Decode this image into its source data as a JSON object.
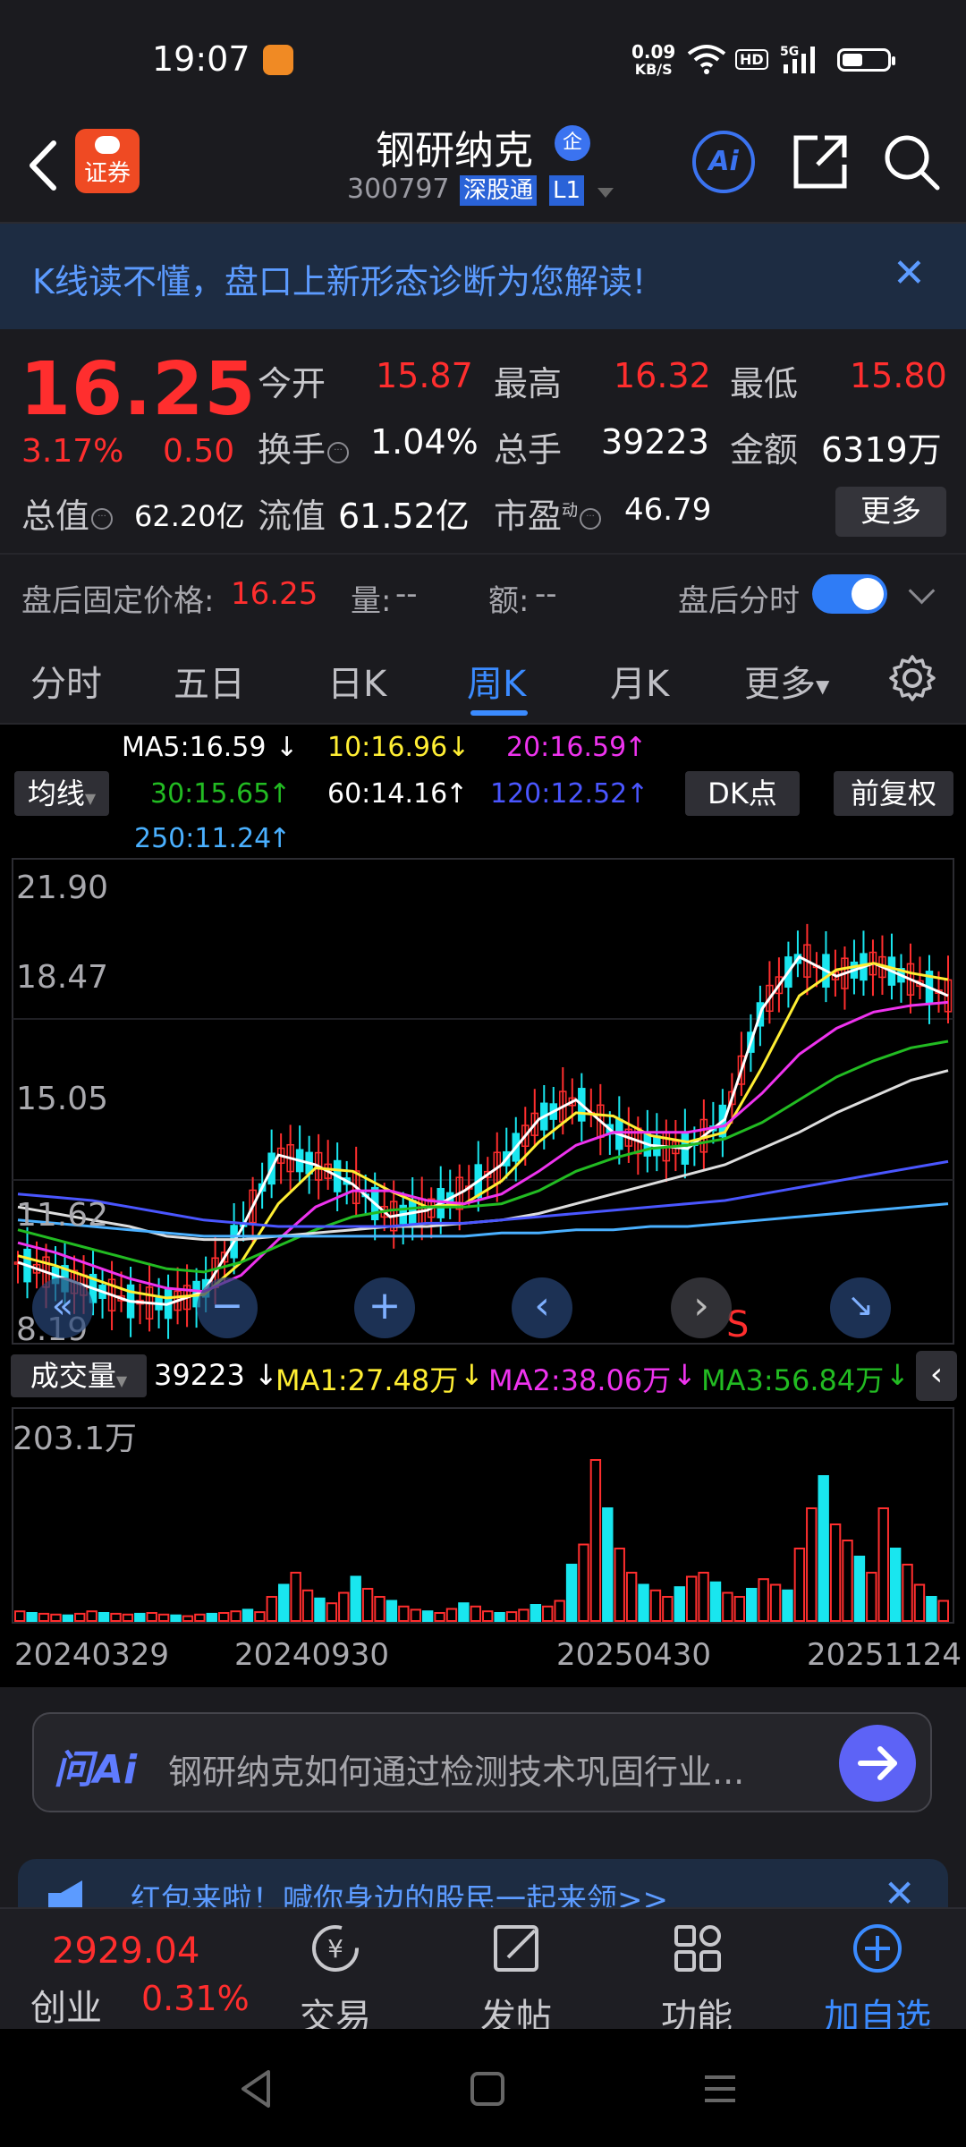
{
  "status_bar": {
    "time": "19:07",
    "net_speed": "0.09",
    "net_unit": "KB/S",
    "hd": "HD",
    "signal": "5G"
  },
  "header": {
    "title": "钢研纳克",
    "title_badge": "企",
    "code": "300797",
    "tag1": "深股通",
    "tag2": "L1",
    "brand_label": "证券",
    "ai_label": "Ai"
  },
  "banner": {
    "text": "K线读不懂，盘口上新形态诊断为您解读!"
  },
  "quote": {
    "price": "16.25",
    "change_pct": "3.17%",
    "change": "0.50",
    "open_label": "今开",
    "open": "15.87",
    "high_label": "最高",
    "high": "16.32",
    "low_label": "最低",
    "low": "15.80",
    "turnover_label": "换手",
    "turnover": "1.04%",
    "volume_label": "总手",
    "volume": "39223",
    "amount_label": "金额",
    "amount": "6319万",
    "mcap_label": "总值",
    "mcap": "62.20亿",
    "float_label": "流值",
    "float_cap": "61.52亿",
    "pe_label": "市盈",
    "pe_sup": "动",
    "pe": "46.79",
    "more": "更多"
  },
  "after_hours": {
    "label": "盘后固定价格:",
    "price": "16.25",
    "vol_label": "量:",
    "vol": "--",
    "amt_label": "额:",
    "amt": "--",
    "toggle_label": "盘后分时"
  },
  "tabs": [
    "分时",
    "五日",
    "日K",
    "周K",
    "月K",
    "更多"
  ],
  "active_tab": "周K",
  "ma": {
    "selector": "均线",
    "ma5": "MA5:16.59",
    "ma10": "10:16.96",
    "ma20": "20:16.59",
    "ma30": "30:15.65",
    "ma60": "60:14.16",
    "ma120": "120:12.52",
    "ma250": "250:11.24",
    "dk": "DK点",
    "fq": "前复权"
  },
  "colors": {
    "up": "#ff2e2e",
    "cyan": "#19e6ef",
    "ma5": "#ffffff",
    "ma10": "#ffee33",
    "ma20": "#ee33ee",
    "ma30": "#22bb22",
    "ma60": "#dddddd",
    "ma120": "#4a56ff",
    "ma250": "#4ab0ff",
    "accent": "#3b8bff"
  },
  "chart_data": [
    {
      "type": "candlestick",
      "title": "",
      "yticks": [
        "21.90",
        "18.47",
        "15.05",
        "11.62",
        "8.19"
      ],
      "ylim": [
        8.19,
        21.9
      ],
      "x_dates": [
        "20240329",
        "20240930",
        "20250430",
        "20251124"
      ],
      "marker_s": "S",
      "series": [
        {
          "name": "MA5",
          "values": [
            10.2,
            9.8,
            9.4,
            9.0,
            8.9,
            9.3,
            11.2,
            13.5,
            13.2,
            12.6,
            11.6,
            11.8,
            12.4,
            13.2,
            14.6,
            15.2,
            14.2,
            13.8,
            13.7,
            14.6,
            18.0,
            19.6,
            19.0,
            19.4,
            18.9,
            18.4
          ]
        },
        {
          "name": "MA10",
          "values": [
            10.4,
            10.1,
            9.7,
            9.3,
            9.1,
            9.2,
            10.2,
            12.0,
            13.1,
            13.0,
            12.4,
            11.9,
            12.0,
            12.7,
            13.9,
            14.8,
            14.7,
            14.1,
            13.9,
            14.2,
            16.2,
            18.4,
            19.2,
            19.4,
            19.1,
            18.9
          ]
        },
        {
          "name": "MA20",
          "values": [
            10.8,
            10.5,
            10.1,
            9.7,
            9.4,
            9.3,
            9.8,
            10.9,
            11.9,
            12.4,
            12.4,
            12.1,
            12.0,
            12.3,
            13.0,
            13.8,
            14.2,
            14.2,
            14.2,
            14.4,
            15.4,
            16.6,
            17.4,
            17.9,
            18.1,
            18.2
          ]
        },
        {
          "name": "MA30",
          "values": [
            11.2,
            10.9,
            10.6,
            10.3,
            10.0,
            9.9,
            10.2,
            10.7,
            11.2,
            11.6,
            11.8,
            11.9,
            11.9,
            12.0,
            12.4,
            13.0,
            13.4,
            13.7,
            13.8,
            14.0,
            14.5,
            15.2,
            15.9,
            16.4,
            16.8,
            17.0
          ]
        },
        {
          "name": "MA60",
          "values": [
            11.9,
            11.7,
            11.5,
            11.3,
            11.0,
            10.9,
            10.9,
            11.0,
            11.1,
            11.2,
            11.3,
            11.3,
            11.4,
            11.5,
            11.7,
            12.0,
            12.3,
            12.6,
            12.9,
            13.2,
            13.7,
            14.2,
            14.8,
            15.3,
            15.8,
            16.1
          ]
        },
        {
          "name": "MA120",
          "values": [
            12.3,
            12.2,
            12.1,
            11.9,
            11.7,
            11.5,
            11.4,
            11.3,
            11.3,
            11.3,
            11.3,
            11.4,
            11.4,
            11.5,
            11.6,
            11.7,
            11.8,
            11.9,
            12.0,
            12.1,
            12.3,
            12.5,
            12.7,
            12.9,
            13.1,
            13.3
          ]
        },
        {
          "name": "MA250",
          "values": [
            11.5,
            11.4,
            11.3,
            11.2,
            11.1,
            11.0,
            11.0,
            11.0,
            11.0,
            11.0,
            11.0,
            11.0,
            11.0,
            11.1,
            11.1,
            11.2,
            11.2,
            11.3,
            11.3,
            11.4,
            11.5,
            11.6,
            11.7,
            11.8,
            11.9,
            12.0
          ]
        }
      ]
    },
    {
      "type": "bar",
      "title": "成交量",
      "current": "39223",
      "ma1": "MA1:27.48万",
      "ma2": "MA2:38.06万",
      "ma3": "MA3:56.84万",
      "ymax_label": "203.1万",
      "values": [
        12,
        10,
        9,
        8,
        7,
        9,
        12,
        10,
        9,
        8,
        9,
        10,
        8,
        7,
        6,
        8,
        9,
        10,
        12,
        14,
        11,
        30,
        45,
        60,
        38,
        28,
        22,
        35,
        55,
        40,
        30,
        25,
        18,
        14,
        12,
        10,
        15,
        22,
        18,
        12,
        10,
        11,
        14,
        20,
        18,
        25,
        70,
        95,
        200,
        140,
        90,
        60,
        45,
        38,
        30,
        42,
        55,
        60,
        48,
        35,
        30,
        40,
        52,
        45,
        38,
        90,
        140,
        180,
        120,
        100,
        80,
        60,
        140,
        90,
        70,
        45,
        30,
        25
      ]
    }
  ],
  "chart_controls": [
    "«",
    "−",
    "+",
    "‹",
    "›",
    "↘"
  ],
  "ask_ai": {
    "logo": "问Ai",
    "text": "钢研纳克如何通过检测技术巩固行业..."
  },
  "redpack": {
    "text": "红包来啦！喊你身边的股民一起来领>>"
  },
  "bottom_nav": {
    "index_value": "2929.04",
    "index_name": "创业",
    "index_pct": "0.31%",
    "trade": "交易",
    "post": "发帖",
    "function": "功能",
    "add_fav": "加自选"
  }
}
